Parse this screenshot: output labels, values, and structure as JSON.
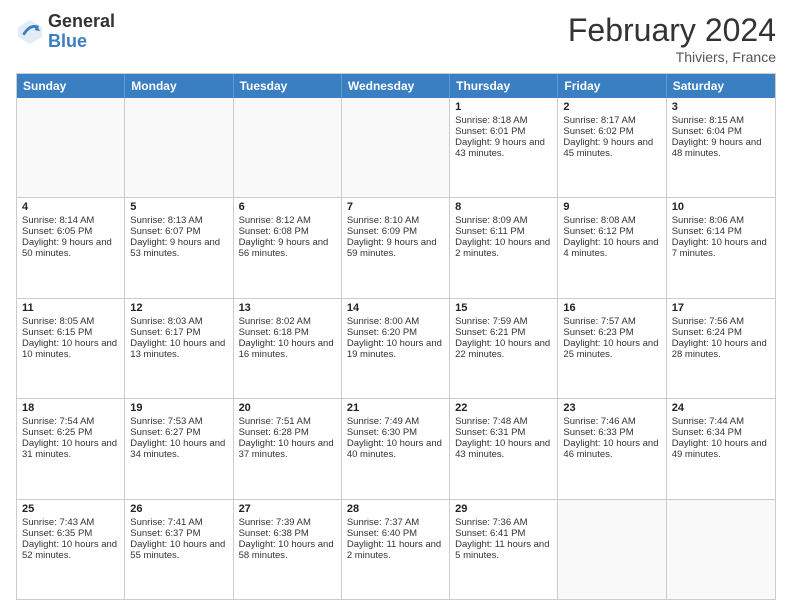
{
  "logo": {
    "line1": "General",
    "line2": "Blue"
  },
  "header": {
    "month": "February 2024",
    "location": "Thiviers, France"
  },
  "weekdays": [
    "Sunday",
    "Monday",
    "Tuesday",
    "Wednesday",
    "Thursday",
    "Friday",
    "Saturday"
  ],
  "weeks": [
    [
      {
        "day": "",
        "sunrise": "",
        "sunset": "",
        "daylight": ""
      },
      {
        "day": "",
        "sunrise": "",
        "sunset": "",
        "daylight": ""
      },
      {
        "day": "",
        "sunrise": "",
        "sunset": "",
        "daylight": ""
      },
      {
        "day": "",
        "sunrise": "",
        "sunset": "",
        "daylight": ""
      },
      {
        "day": "1",
        "sunrise": "Sunrise: 8:18 AM",
        "sunset": "Sunset: 6:01 PM",
        "daylight": "Daylight: 9 hours and 43 minutes."
      },
      {
        "day": "2",
        "sunrise": "Sunrise: 8:17 AM",
        "sunset": "Sunset: 6:02 PM",
        "daylight": "Daylight: 9 hours and 45 minutes."
      },
      {
        "day": "3",
        "sunrise": "Sunrise: 8:15 AM",
        "sunset": "Sunset: 6:04 PM",
        "daylight": "Daylight: 9 hours and 48 minutes."
      }
    ],
    [
      {
        "day": "4",
        "sunrise": "Sunrise: 8:14 AM",
        "sunset": "Sunset: 6:05 PM",
        "daylight": "Daylight: 9 hours and 50 minutes."
      },
      {
        "day": "5",
        "sunrise": "Sunrise: 8:13 AM",
        "sunset": "Sunset: 6:07 PM",
        "daylight": "Daylight: 9 hours and 53 minutes."
      },
      {
        "day": "6",
        "sunrise": "Sunrise: 8:12 AM",
        "sunset": "Sunset: 6:08 PM",
        "daylight": "Daylight: 9 hours and 56 minutes."
      },
      {
        "day": "7",
        "sunrise": "Sunrise: 8:10 AM",
        "sunset": "Sunset: 6:09 PM",
        "daylight": "Daylight: 9 hours and 59 minutes."
      },
      {
        "day": "8",
        "sunrise": "Sunrise: 8:09 AM",
        "sunset": "Sunset: 6:11 PM",
        "daylight": "Daylight: 10 hours and 2 minutes."
      },
      {
        "day": "9",
        "sunrise": "Sunrise: 8:08 AM",
        "sunset": "Sunset: 6:12 PM",
        "daylight": "Daylight: 10 hours and 4 minutes."
      },
      {
        "day": "10",
        "sunrise": "Sunrise: 8:06 AM",
        "sunset": "Sunset: 6:14 PM",
        "daylight": "Daylight: 10 hours and 7 minutes."
      }
    ],
    [
      {
        "day": "11",
        "sunrise": "Sunrise: 8:05 AM",
        "sunset": "Sunset: 6:15 PM",
        "daylight": "Daylight: 10 hours and 10 minutes."
      },
      {
        "day": "12",
        "sunrise": "Sunrise: 8:03 AM",
        "sunset": "Sunset: 6:17 PM",
        "daylight": "Daylight: 10 hours and 13 minutes."
      },
      {
        "day": "13",
        "sunrise": "Sunrise: 8:02 AM",
        "sunset": "Sunset: 6:18 PM",
        "daylight": "Daylight: 10 hours and 16 minutes."
      },
      {
        "day": "14",
        "sunrise": "Sunrise: 8:00 AM",
        "sunset": "Sunset: 6:20 PM",
        "daylight": "Daylight: 10 hours and 19 minutes."
      },
      {
        "day": "15",
        "sunrise": "Sunrise: 7:59 AM",
        "sunset": "Sunset: 6:21 PM",
        "daylight": "Daylight: 10 hours and 22 minutes."
      },
      {
        "day": "16",
        "sunrise": "Sunrise: 7:57 AM",
        "sunset": "Sunset: 6:23 PM",
        "daylight": "Daylight: 10 hours and 25 minutes."
      },
      {
        "day": "17",
        "sunrise": "Sunrise: 7:56 AM",
        "sunset": "Sunset: 6:24 PM",
        "daylight": "Daylight: 10 hours and 28 minutes."
      }
    ],
    [
      {
        "day": "18",
        "sunrise": "Sunrise: 7:54 AM",
        "sunset": "Sunset: 6:25 PM",
        "daylight": "Daylight: 10 hours and 31 minutes."
      },
      {
        "day": "19",
        "sunrise": "Sunrise: 7:53 AM",
        "sunset": "Sunset: 6:27 PM",
        "daylight": "Daylight: 10 hours and 34 minutes."
      },
      {
        "day": "20",
        "sunrise": "Sunrise: 7:51 AM",
        "sunset": "Sunset: 6:28 PM",
        "daylight": "Daylight: 10 hours and 37 minutes."
      },
      {
        "day": "21",
        "sunrise": "Sunrise: 7:49 AM",
        "sunset": "Sunset: 6:30 PM",
        "daylight": "Daylight: 10 hours and 40 minutes."
      },
      {
        "day": "22",
        "sunrise": "Sunrise: 7:48 AM",
        "sunset": "Sunset: 6:31 PM",
        "daylight": "Daylight: 10 hours and 43 minutes."
      },
      {
        "day": "23",
        "sunrise": "Sunrise: 7:46 AM",
        "sunset": "Sunset: 6:33 PM",
        "daylight": "Daylight: 10 hours and 46 minutes."
      },
      {
        "day": "24",
        "sunrise": "Sunrise: 7:44 AM",
        "sunset": "Sunset: 6:34 PM",
        "daylight": "Daylight: 10 hours and 49 minutes."
      }
    ],
    [
      {
        "day": "25",
        "sunrise": "Sunrise: 7:43 AM",
        "sunset": "Sunset: 6:35 PM",
        "daylight": "Daylight: 10 hours and 52 minutes."
      },
      {
        "day": "26",
        "sunrise": "Sunrise: 7:41 AM",
        "sunset": "Sunset: 6:37 PM",
        "daylight": "Daylight: 10 hours and 55 minutes."
      },
      {
        "day": "27",
        "sunrise": "Sunrise: 7:39 AM",
        "sunset": "Sunset: 6:38 PM",
        "daylight": "Daylight: 10 hours and 58 minutes."
      },
      {
        "day": "28",
        "sunrise": "Sunrise: 7:37 AM",
        "sunset": "Sunset: 6:40 PM",
        "daylight": "Daylight: 11 hours and 2 minutes."
      },
      {
        "day": "29",
        "sunrise": "Sunrise: 7:36 AM",
        "sunset": "Sunset: 6:41 PM",
        "daylight": "Daylight: 11 hours and 5 minutes."
      },
      {
        "day": "",
        "sunrise": "",
        "sunset": "",
        "daylight": ""
      },
      {
        "day": "",
        "sunrise": "",
        "sunset": "",
        "daylight": ""
      }
    ]
  ]
}
